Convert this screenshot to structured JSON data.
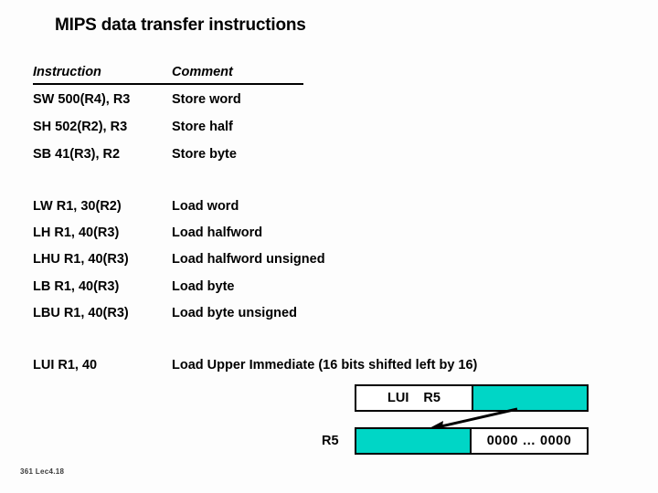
{
  "slide": {
    "title": "MIPS data transfer instructions",
    "footer": "361  Lec4.18",
    "accent_color": "#00d6c6",
    "background_color": "#fdfdfd",
    "text_color": "#000000"
  },
  "table": {
    "headers": {
      "instruction": "Instruction",
      "comment": "Comment"
    },
    "store_rows": [
      {
        "instruction": "SW  500(R4), R3",
        "comment": "Store word"
      },
      {
        "instruction": "SH  502(R2), R3",
        "comment": "Store half"
      },
      {
        "instruction": "SB  41(R3), R2",
        "comment": "Store byte"
      }
    ],
    "load_rows": [
      {
        "instruction": "LW R1, 30(R2)",
        "comment": "Load word"
      },
      {
        "instruction": "LH  R1, 40(R3)",
        "comment": "Load halfword"
      },
      {
        "instruction": "LHU  R1, 40(R3)",
        "comment": "Load halfword unsigned"
      },
      {
        "instruction": "LB  R1, 40(R3)",
        "comment": "Load byte"
      },
      {
        "instruction": "LBU R1, 40(R3)",
        "comment": "Load byte unsigned"
      }
    ],
    "lui_row": {
      "instruction": "LUI R1, 40",
      "comment": "Load Upper Immediate (16 bits shifted left by 16)"
    }
  },
  "diagram": {
    "instruction_word": {
      "opcode": "LUI",
      "register": "R5",
      "immediate_field": ""
    },
    "register_word": {
      "label": "R5",
      "upper_half": "",
      "lower_half": "0000 … 0000"
    },
    "arrow": "shift-left-arrow"
  }
}
